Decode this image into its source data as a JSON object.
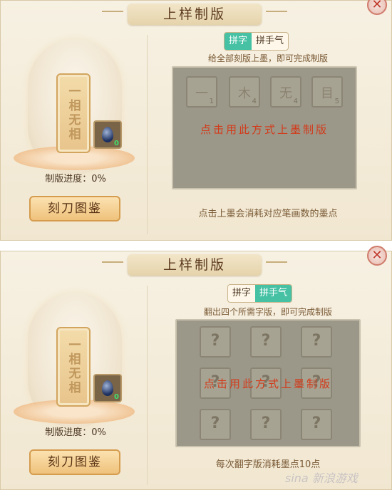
{
  "panel1": {
    "title": "上样制版",
    "close": "✕",
    "tablet_text": "一相无相",
    "ink_count": "0",
    "progress": "制版进度：0%",
    "tujian_button": "刻刀图鉴",
    "tabs": [
      {
        "label": "拼字",
        "active": true
      },
      {
        "label": "拼手气",
        "active": false
      }
    ],
    "instruction": "给全部刻版上墨，即可完成制版",
    "tiles": [
      {
        "char": "一",
        "num": "1"
      },
      {
        "char": "木",
        "num": "4"
      },
      {
        "char": "无",
        "num": "4"
      },
      {
        "char": "目",
        "num": "5"
      }
    ],
    "board_message": "点击用此方式上墨制版",
    "footer": "点击上墨会消耗对应笔画数的墨点"
  },
  "panel2": {
    "title": "上样制版",
    "close": "✕",
    "tablet_text": "一相无相",
    "ink_count": "0",
    "progress": "制版进度：0%",
    "tujian_button": "刻刀图鉴",
    "tabs": [
      {
        "label": "拼字",
        "active": false
      },
      {
        "label": "拼手气",
        "active": true
      }
    ],
    "instruction": "翻出四个所需字版，即可完成制版",
    "tiles": [
      "?",
      "?",
      "?",
      "?",
      "?",
      "?",
      "?",
      "?",
      "?"
    ],
    "board_message": "点击用此方式上墨制版",
    "footer": "每次翻字版消耗墨点10点"
  },
  "watermark": "sina 新浪游戏",
  "colors": {
    "tab_active": "#46c1a4",
    "message_red": "#d23a1a",
    "board_gray": "#9c9889"
  },
  "icons": [
    "close-icon",
    "ink-drop-icon"
  ]
}
